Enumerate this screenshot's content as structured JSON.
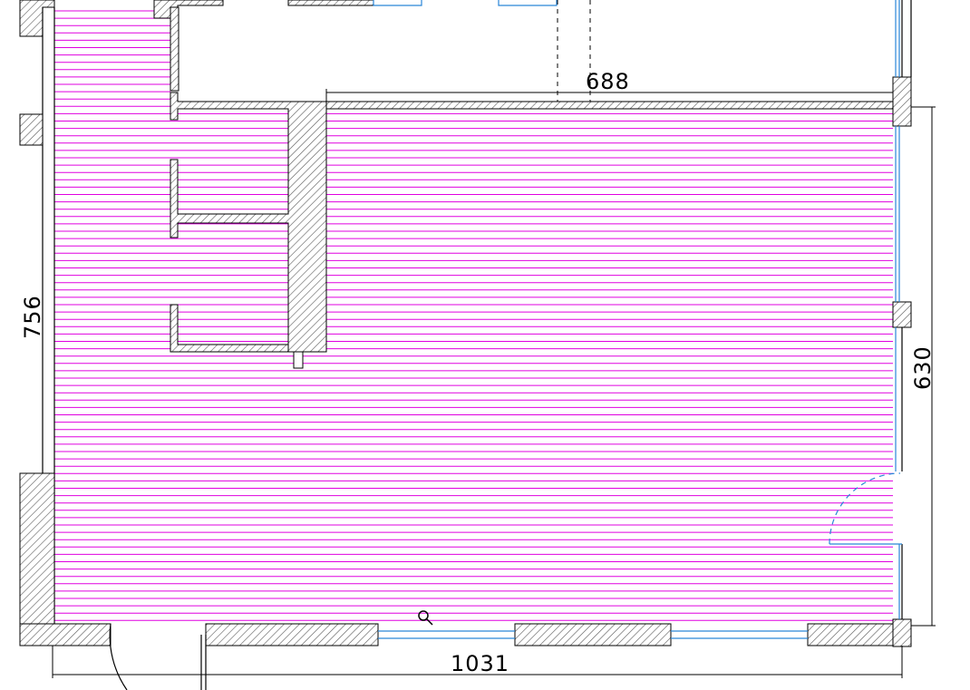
{
  "drawing": {
    "dimensions": {
      "top_width": "688",
      "right_height": "630",
      "left_height": "756",
      "bottom_width": "1031"
    },
    "colors": {
      "floor_hatch": "#e000e0",
      "wall_outline": "#000000",
      "wall_hatch": "#6b6b6b",
      "window": "#2a86d8",
      "background": "#ffffff"
    },
    "tool": {
      "cursor": "zoom-icon"
    }
  }
}
